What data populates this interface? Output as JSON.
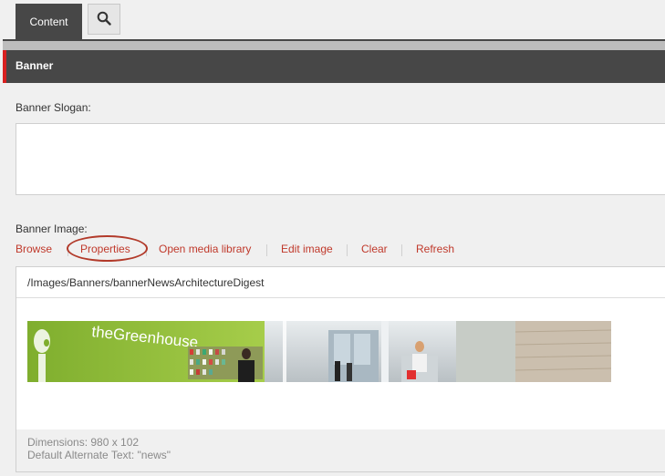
{
  "tabs": {
    "content_label": "Content",
    "search_icon": "search-icon"
  },
  "section": {
    "title": "Banner"
  },
  "slogan": {
    "label": "Banner Slogan:",
    "value": ""
  },
  "image_field": {
    "label": "Banner Image:",
    "actions": {
      "browse": "Browse",
      "properties": "Properties",
      "open_media_library": "Open media library",
      "edit_image": "Edit image",
      "clear": "Clear",
      "refresh": "Refresh"
    },
    "path": "/Images/Banners/bannerNewsArchitectureDigest",
    "thumbnail_text": "theGreenhouse",
    "dimensions": "Dimensions: 980 x 102",
    "alt_text": "Default Alternate Text: \"news\""
  },
  "colors": {
    "accent": "#d82020",
    "link": "#c0392b",
    "header_bg": "#474747"
  }
}
